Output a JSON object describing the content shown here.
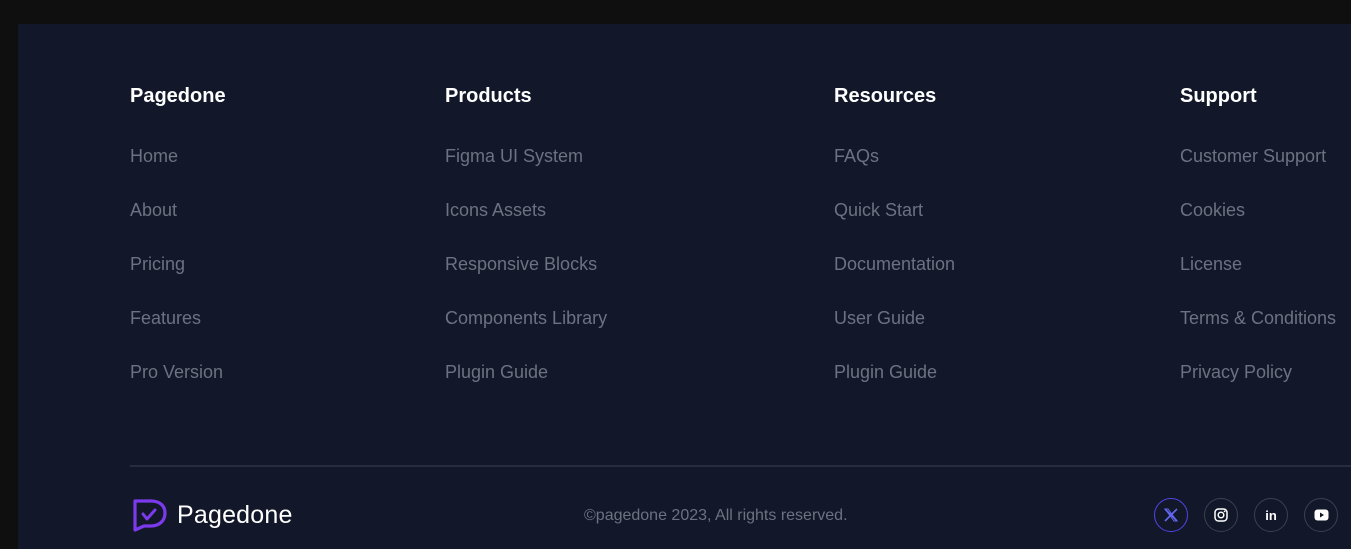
{
  "columns": [
    {
      "title": "Pagedone",
      "links": [
        "Home",
        "About",
        "Pricing",
        "Features",
        "Pro Version"
      ]
    },
    {
      "title": "Products",
      "links": [
        "Figma UI System",
        "Icons Assets",
        "Responsive Blocks",
        "Components Library",
        "Plugin Guide"
      ]
    },
    {
      "title": "Resources",
      "links": [
        "FAQs",
        "Quick Start",
        "Documentation",
        "User Guide",
        "Plugin Guide"
      ]
    },
    {
      "title": "Support",
      "links": [
        "Customer Support",
        "Cookies",
        "License",
        "Terms & Conditions",
        "Privacy Policy"
      ]
    }
  ],
  "brand": {
    "name": "Pagedone",
    "logo_icon": "pagedone-logo-icon",
    "accent": "#6d3cf0"
  },
  "copyright": "©pagedone 2023, All rights reserved.",
  "socials": [
    {
      "icon": "x-twitter-icon",
      "glyph": "𝕏",
      "active": true
    },
    {
      "icon": "instagram-icon",
      "glyph": "",
      "active": false
    },
    {
      "icon": "linkedin-icon",
      "glyph": "in",
      "active": false
    },
    {
      "icon": "youtube-icon",
      "glyph": "",
      "active": false
    }
  ],
  "colors": {
    "background": "#121829",
    "heading": "#ffffff",
    "link": "#6b7282",
    "social_active": "#4f46e5"
  }
}
